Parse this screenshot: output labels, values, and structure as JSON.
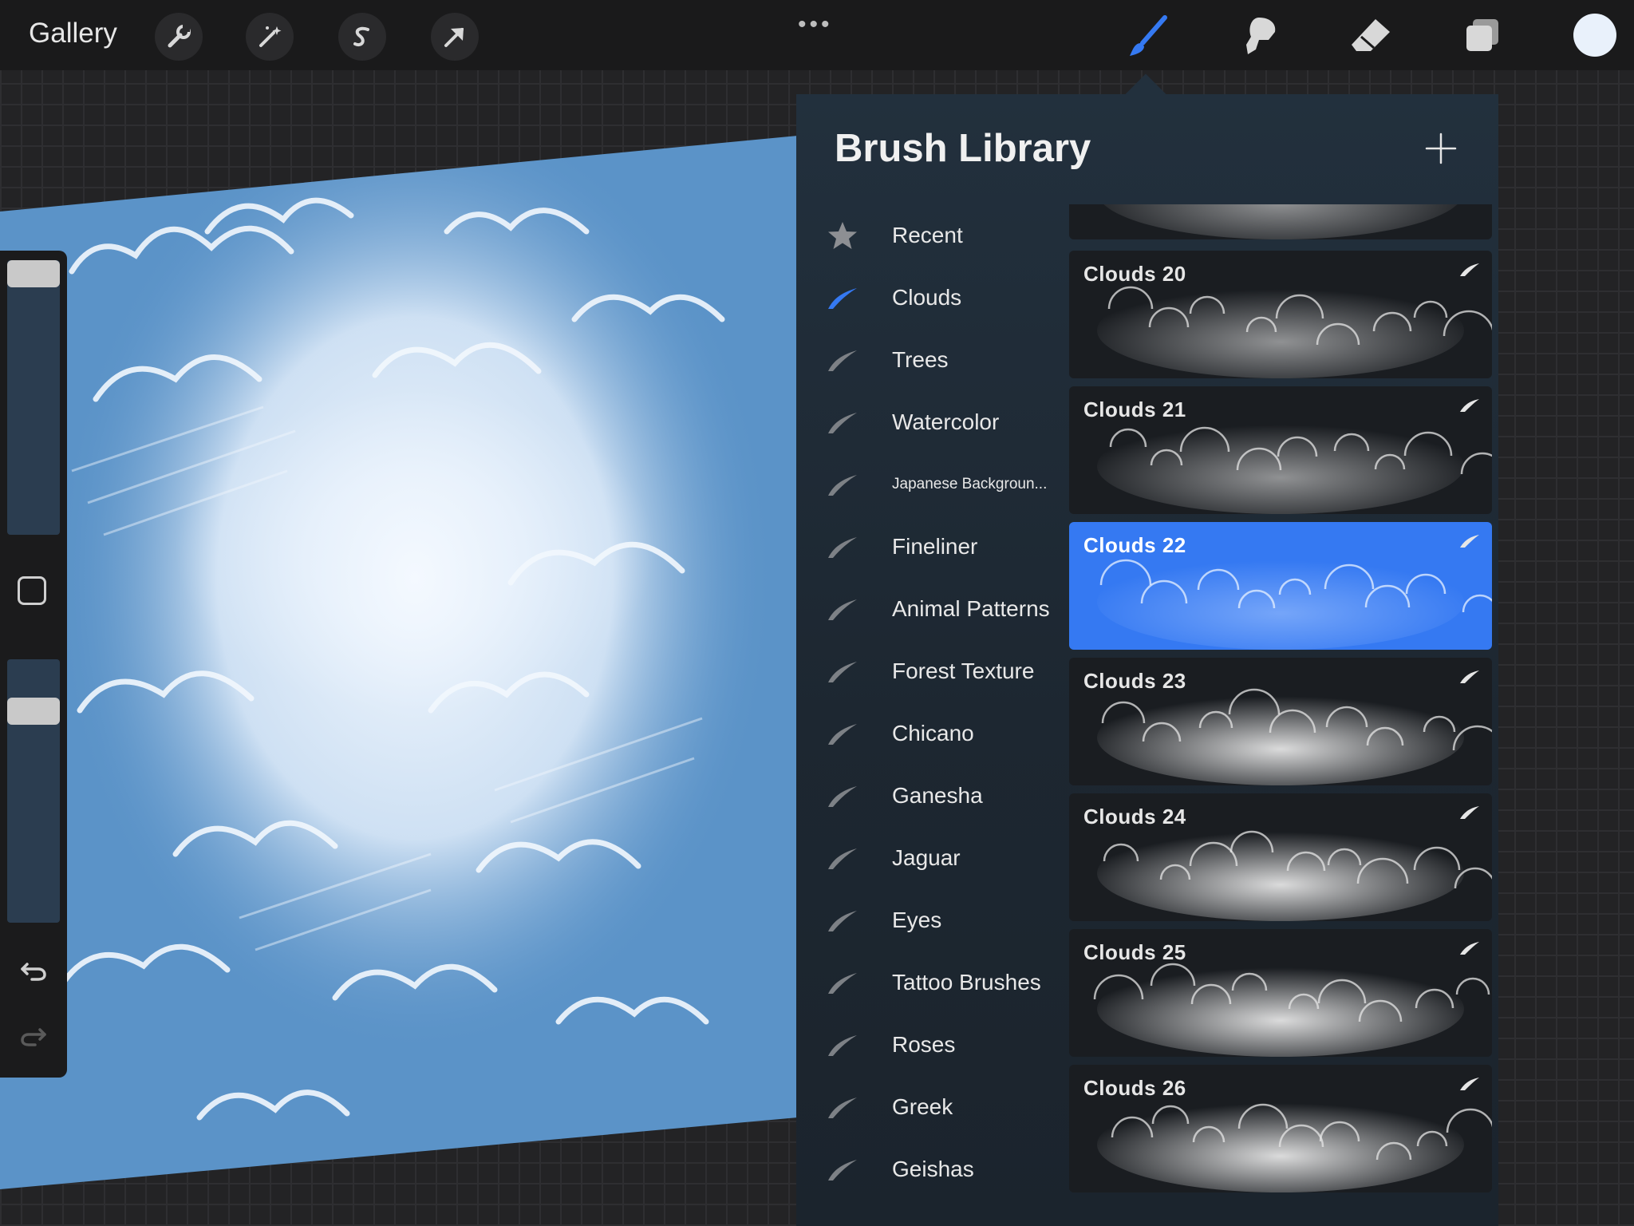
{
  "topbar": {
    "gallery_label": "Gallery",
    "more_dots": "•••",
    "active_tool": "brush",
    "accent_color": "#3579f2",
    "current_color": "#e9f1fb"
  },
  "brush_library": {
    "title": "Brush Library",
    "add_icon": "plus-icon",
    "sets": [
      {
        "label": "Recent",
        "icon": "star-icon",
        "active": false
      },
      {
        "label": "Clouds",
        "icon": "brush-stroke-icon",
        "active": true
      },
      {
        "label": "Trees",
        "icon": "brush-stroke-icon",
        "active": false
      },
      {
        "label": "Watercolor",
        "icon": "brush-stroke-icon",
        "active": false
      },
      {
        "label": "Japanese Backgroun...",
        "icon": "brush-stroke-icon",
        "active": false
      },
      {
        "label": "Fineliner",
        "icon": "brush-stroke-icon",
        "active": false
      },
      {
        "label": "Animal Patterns",
        "icon": "brush-stroke-icon",
        "active": false
      },
      {
        "label": "Forest Texture",
        "icon": "brush-stroke-icon",
        "active": false
      },
      {
        "label": "Chicano",
        "icon": "brush-stroke-icon",
        "active": false
      },
      {
        "label": "Ganesha",
        "icon": "brush-stroke-icon",
        "active": false
      },
      {
        "label": "Jaguar",
        "icon": "brush-stroke-icon",
        "active": false
      },
      {
        "label": "Eyes",
        "icon": "brush-stroke-icon",
        "active": false
      },
      {
        "label": "Tattoo Brushes",
        "icon": "brush-stroke-icon",
        "active": false
      },
      {
        "label": "Roses",
        "icon": "brush-stroke-icon",
        "active": false
      },
      {
        "label": "Greek",
        "icon": "brush-stroke-icon",
        "active": false
      },
      {
        "label": "Geishas",
        "icon": "brush-stroke-icon",
        "active": false
      }
    ],
    "brushes": [
      {
        "name": "",
        "selected": false
      },
      {
        "name": "Clouds 20",
        "selected": false
      },
      {
        "name": "Clouds 21",
        "selected": false
      },
      {
        "name": "Clouds 22",
        "selected": true
      },
      {
        "name": "Clouds 23",
        "selected": false
      },
      {
        "name": "Clouds 24",
        "selected": false
      },
      {
        "name": "Clouds 25",
        "selected": false
      },
      {
        "name": "Clouds 26",
        "selected": false
      }
    ]
  },
  "sidebar": {
    "brush_size": 0.96,
    "opacity": 0.95
  }
}
